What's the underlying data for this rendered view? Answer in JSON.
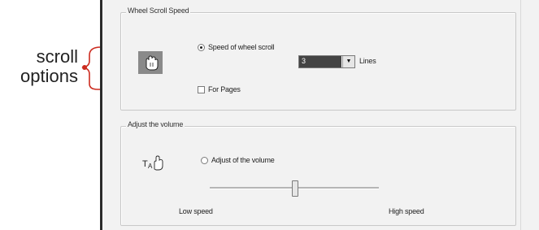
{
  "callout": {
    "line1": "scroll",
    "line2": "options",
    "color": "#cc2b1f"
  },
  "wheel_group": {
    "title": "Wheel Scroll Speed",
    "icon": "hand-scroll-icon",
    "radio_label": "Speed of wheel scroll",
    "radio_selected": true,
    "select_value": "3",
    "lines_label": "Lines",
    "pages_label": "For Pages",
    "pages_checked": false
  },
  "volume_group": {
    "title": "Adjust the volume",
    "icon": "volume-hand-icon",
    "checkbox_label": "Adjust of the volume",
    "checkbox_checked": false,
    "slider_value_fraction": 0.5,
    "low_label": "Low speed",
    "high_label": "High speed"
  }
}
